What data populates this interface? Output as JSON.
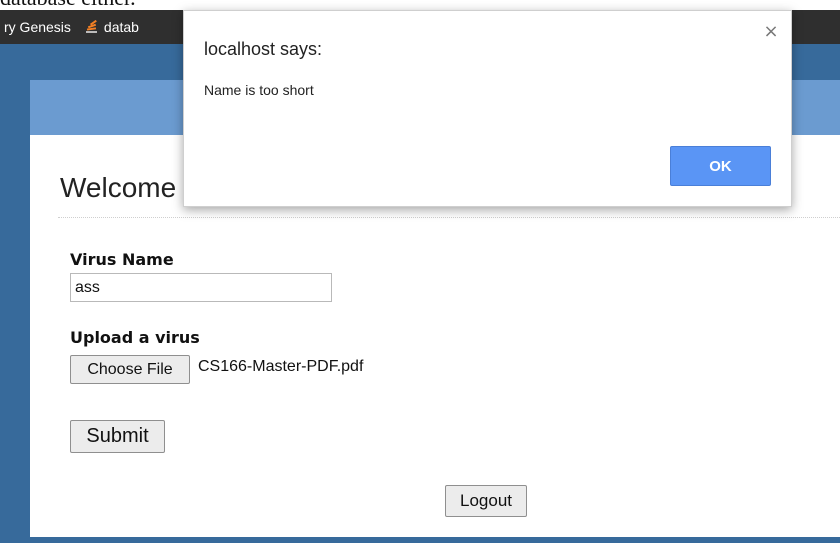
{
  "page_top_text": "database either.",
  "bookmarks": [
    {
      "label": "ry Genesis",
      "icon": ""
    },
    {
      "label": "datab",
      "icon": "stack-icon"
    }
  ],
  "page": {
    "welcome": "Welcome",
    "virus_name_label": "Virus Name",
    "virus_name_value": "ass",
    "upload_label": "Upload a virus",
    "choose_file_label": "Choose File",
    "file_name": "CS166-Master-PDF.pdf",
    "submit_label": "Submit",
    "logout_label": "Logout"
  },
  "dialog": {
    "title": "localhost says:",
    "message": "Name is too short",
    "ok_label": "OK",
    "close_glyph": "×"
  },
  "colors": {
    "page_background": "#376a9b",
    "panel_header": "#6b9bd0",
    "ok_button": "#5a95f5",
    "bookmarks_bar": "#2f2f2f"
  }
}
